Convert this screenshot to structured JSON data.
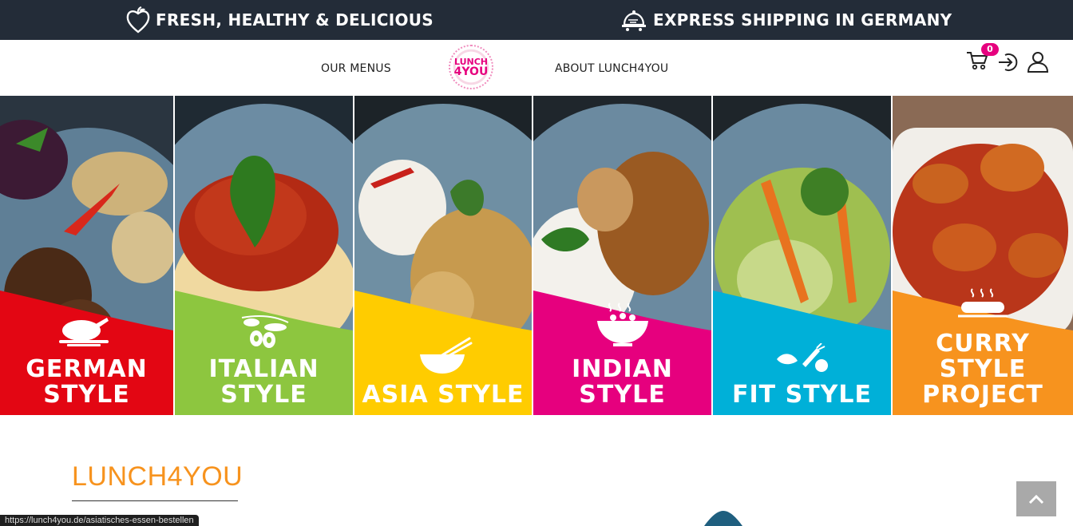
{
  "topbar": {
    "promo_1": "FRESH, HEALTHY & DELICIOUS",
    "promo_1_icon": "apple-heart-icon",
    "promo_2": "EXPRESS SHIPPING IN GERMANY",
    "promo_2_icon": "delivery-cloche-icon"
  },
  "nav": {
    "menus": "OUR MENUS",
    "logo_line1": "LUNCH",
    "logo_line2": "4YOU",
    "about": "ABOUT LUNCH4YOU",
    "cart_count": "0",
    "cart_icon": "cart-icon",
    "login_icon": "login-icon",
    "user_icon": "user-icon"
  },
  "tiles": [
    {
      "line1": "GERMAN",
      "line2": "STYLE",
      "color": "#e30613",
      "icon": "roast-chicken-icon"
    },
    {
      "line1": "ITALIAN",
      "line2": "STYLE",
      "color": "#8dc63f",
      "icon": "olives-icon"
    },
    {
      "line1": "",
      "line2": "ASIA STYLE",
      "color": "#ffcc00",
      "icon": "bowl-chopsticks-icon"
    },
    {
      "line1": "INDIAN",
      "line2": "STYLE",
      "color": "#e6007e",
      "icon": "curry-bowl-icon"
    },
    {
      "line1": "",
      "line2": "FIT STYLE",
      "color": "#00b0d8",
      "icon": "vegetables-icon"
    },
    {
      "line1": "CURRY",
      "line2": "STYLE",
      "line3": "PROJECT",
      "color": "#f7931e",
      "icon": "sausage-grill-icon"
    }
  ],
  "content": {
    "brand_title": "LUNCH4YOU"
  },
  "status_bar": {
    "url": "https://lunch4you.de/asiatisches-essen-bestellen"
  },
  "colors": {
    "topbar": "#232c38",
    "accent_pink": "#e6007e",
    "brand_orange": "#f7931e"
  }
}
